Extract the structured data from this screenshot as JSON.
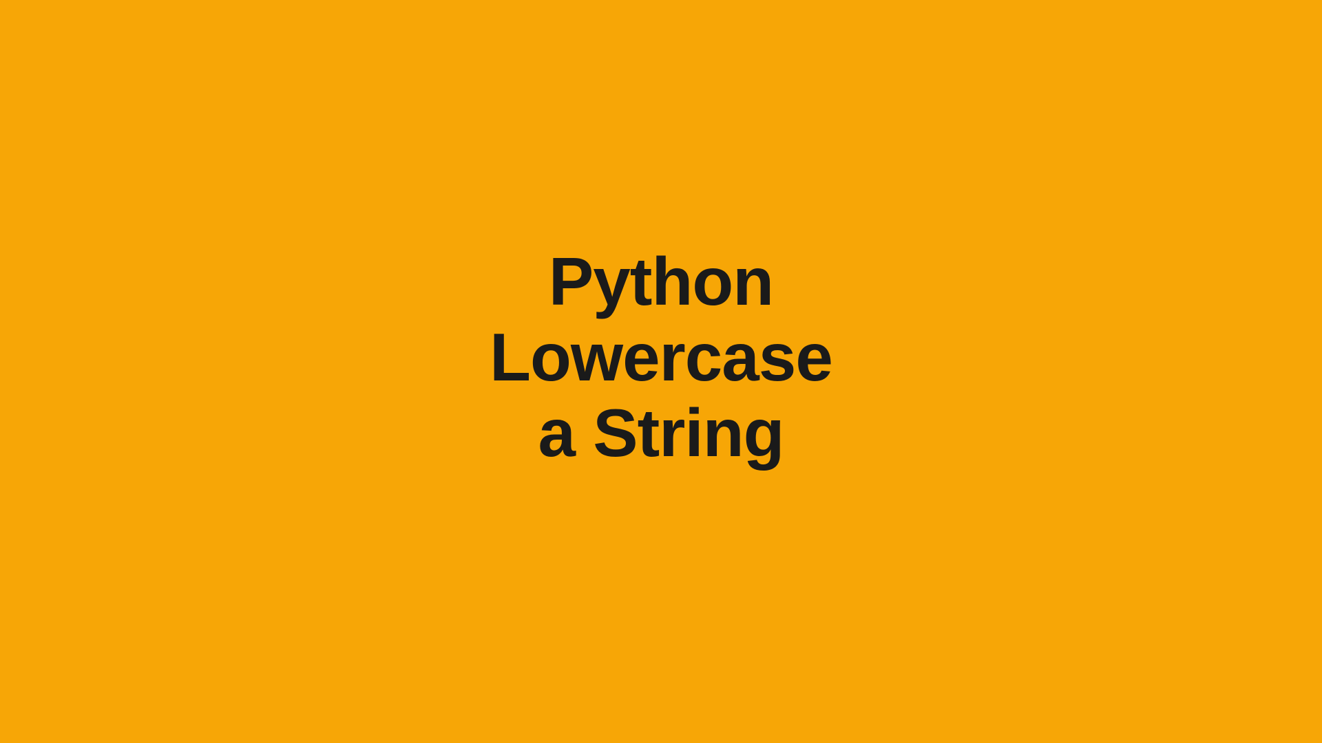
{
  "title": {
    "line1": "Python",
    "line2": "Lowercase",
    "line3": "a String"
  },
  "colors": {
    "background": "#f7a606",
    "text": "#1a1a1a"
  }
}
